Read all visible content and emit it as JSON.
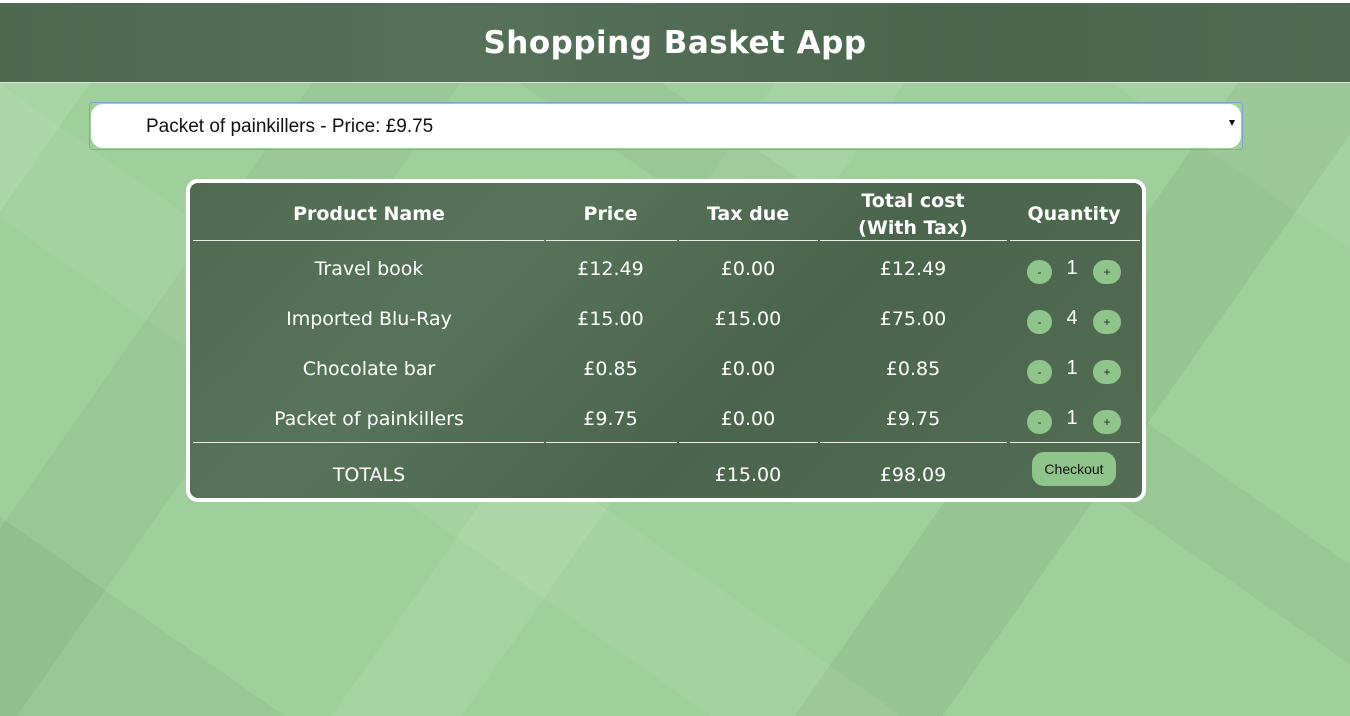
{
  "app": {
    "title": "Shopping Basket App"
  },
  "product_select": {
    "selected": "Packet of painkillers - Price: £9.75"
  },
  "table": {
    "headers": {
      "name": "Product Name",
      "price": "Price",
      "tax": "Tax due",
      "total_line1": "Total cost",
      "total_line2": "(With Tax)",
      "quantity": "Quantity"
    },
    "rows": [
      {
        "name": "Travel book",
        "price": "£12.49",
        "tax": "£0.00",
        "total": "£12.49",
        "qty": "1"
      },
      {
        "name": "Imported Blu-Ray",
        "price": "£15.00",
        "tax": "£15.00",
        "total": "£75.00",
        "qty": "4"
      },
      {
        "name": "Chocolate bar",
        "price": "£0.85",
        "tax": "£0.00",
        "total": "£0.85",
        "qty": "1"
      },
      {
        "name": "Packet of painkillers",
        "price": "£9.75",
        "tax": "£0.00",
        "total": "£9.75",
        "qty": "1"
      }
    ],
    "totals": {
      "label": "TOTALS",
      "tax": "£15.00",
      "total": "£98.09"
    },
    "decrement_label": "-",
    "increment_label": "+",
    "checkout_label": "Checkout"
  },
  "colors": {
    "background": "#9fcf9b",
    "panel": "#4f6a50",
    "button": "#8fc48b"
  }
}
